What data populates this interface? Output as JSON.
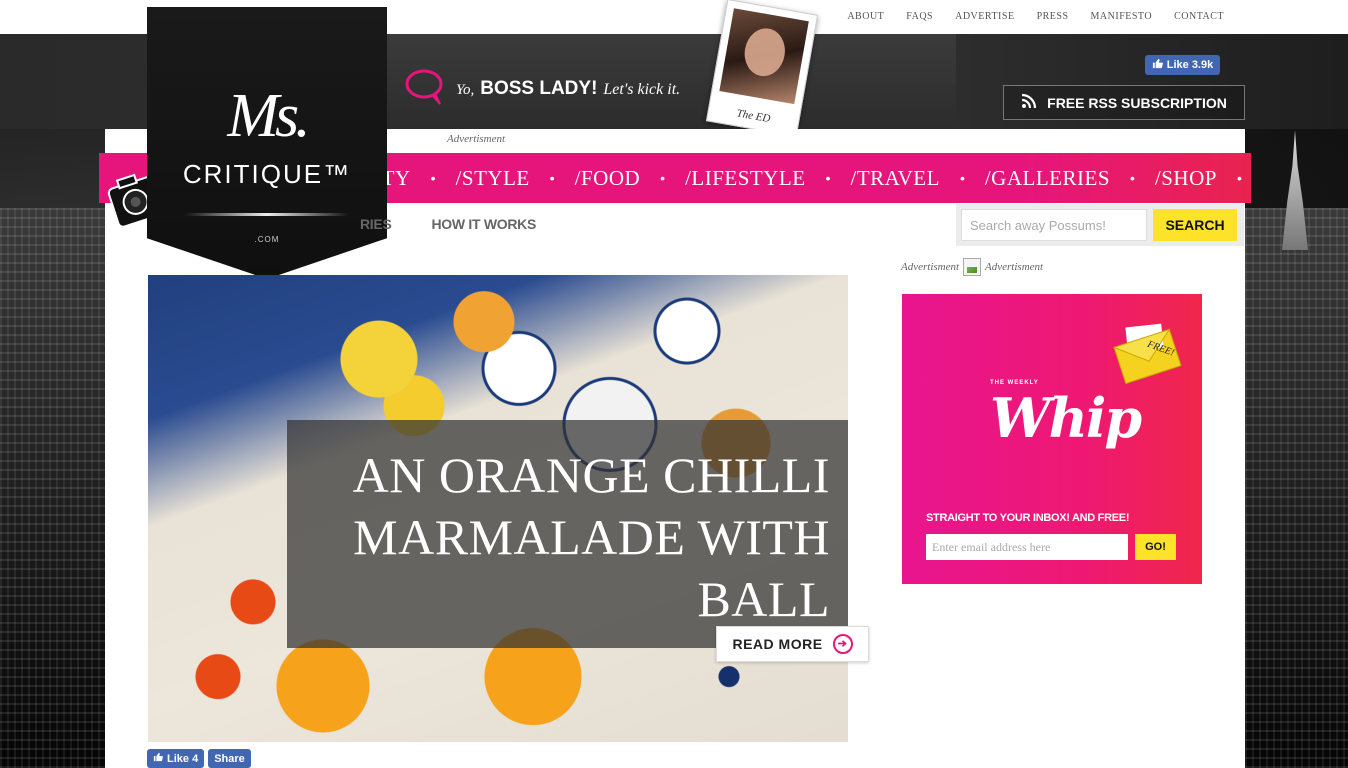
{
  "top_nav": {
    "links": [
      "ABOUT",
      "FAQS",
      "ADVERTISE",
      "PRESS",
      "MANIFESTO",
      "CONTACT"
    ]
  },
  "logo": {
    "ms": "Ms.",
    "critique": "CRITIQUE™",
    "com": ".COM"
  },
  "tagline": {
    "yo": "Yo,",
    "boss": "BOSS LADY!",
    "kick": "Let's kick it."
  },
  "polaroid": {
    "caption": "The ED"
  },
  "header": {
    "fb_like": "Like 3.9k",
    "rss_label": "FREE RSS SUBSCRIPTION",
    "advert": "Advertisment"
  },
  "main_nav": {
    "items": [
      "/BEAUTY",
      "/STYLE",
      "/FOOD",
      "/LIFESTYLE",
      "/TRAVEL",
      "/GALLERIES",
      "/SHOP"
    ],
    "partial_first": "UTY"
  },
  "sub_nav": {
    "items": [
      "CATEGORIES",
      "HOW IT WORKS"
    ],
    "partial_first": "RIES"
  },
  "search": {
    "placeholder": "Search away Possums!",
    "button": "SEARCH"
  },
  "feature": {
    "title": "AN ORANGE CHILLI MARMALADE WITH BALL",
    "read_more": "READ MORE",
    "fb_like": "Like 4",
    "fb_share": "Share"
  },
  "sidebar": {
    "advert_left": "Advertisment",
    "advert_right": "Advertisment",
    "ad": {
      "free_tag": "FREE!",
      "small": "THE WEEKLY",
      "brand": "Whip",
      "cta": "STRAIGHT TO YOUR INBOX! AND FREE!",
      "email_placeholder": "Enter email address here",
      "go": "GO!"
    }
  },
  "colors": {
    "pink": "#e6157c",
    "yellow": "#fce32a",
    "facebook": "#4267b2",
    "dark": "#1a1a1a"
  }
}
